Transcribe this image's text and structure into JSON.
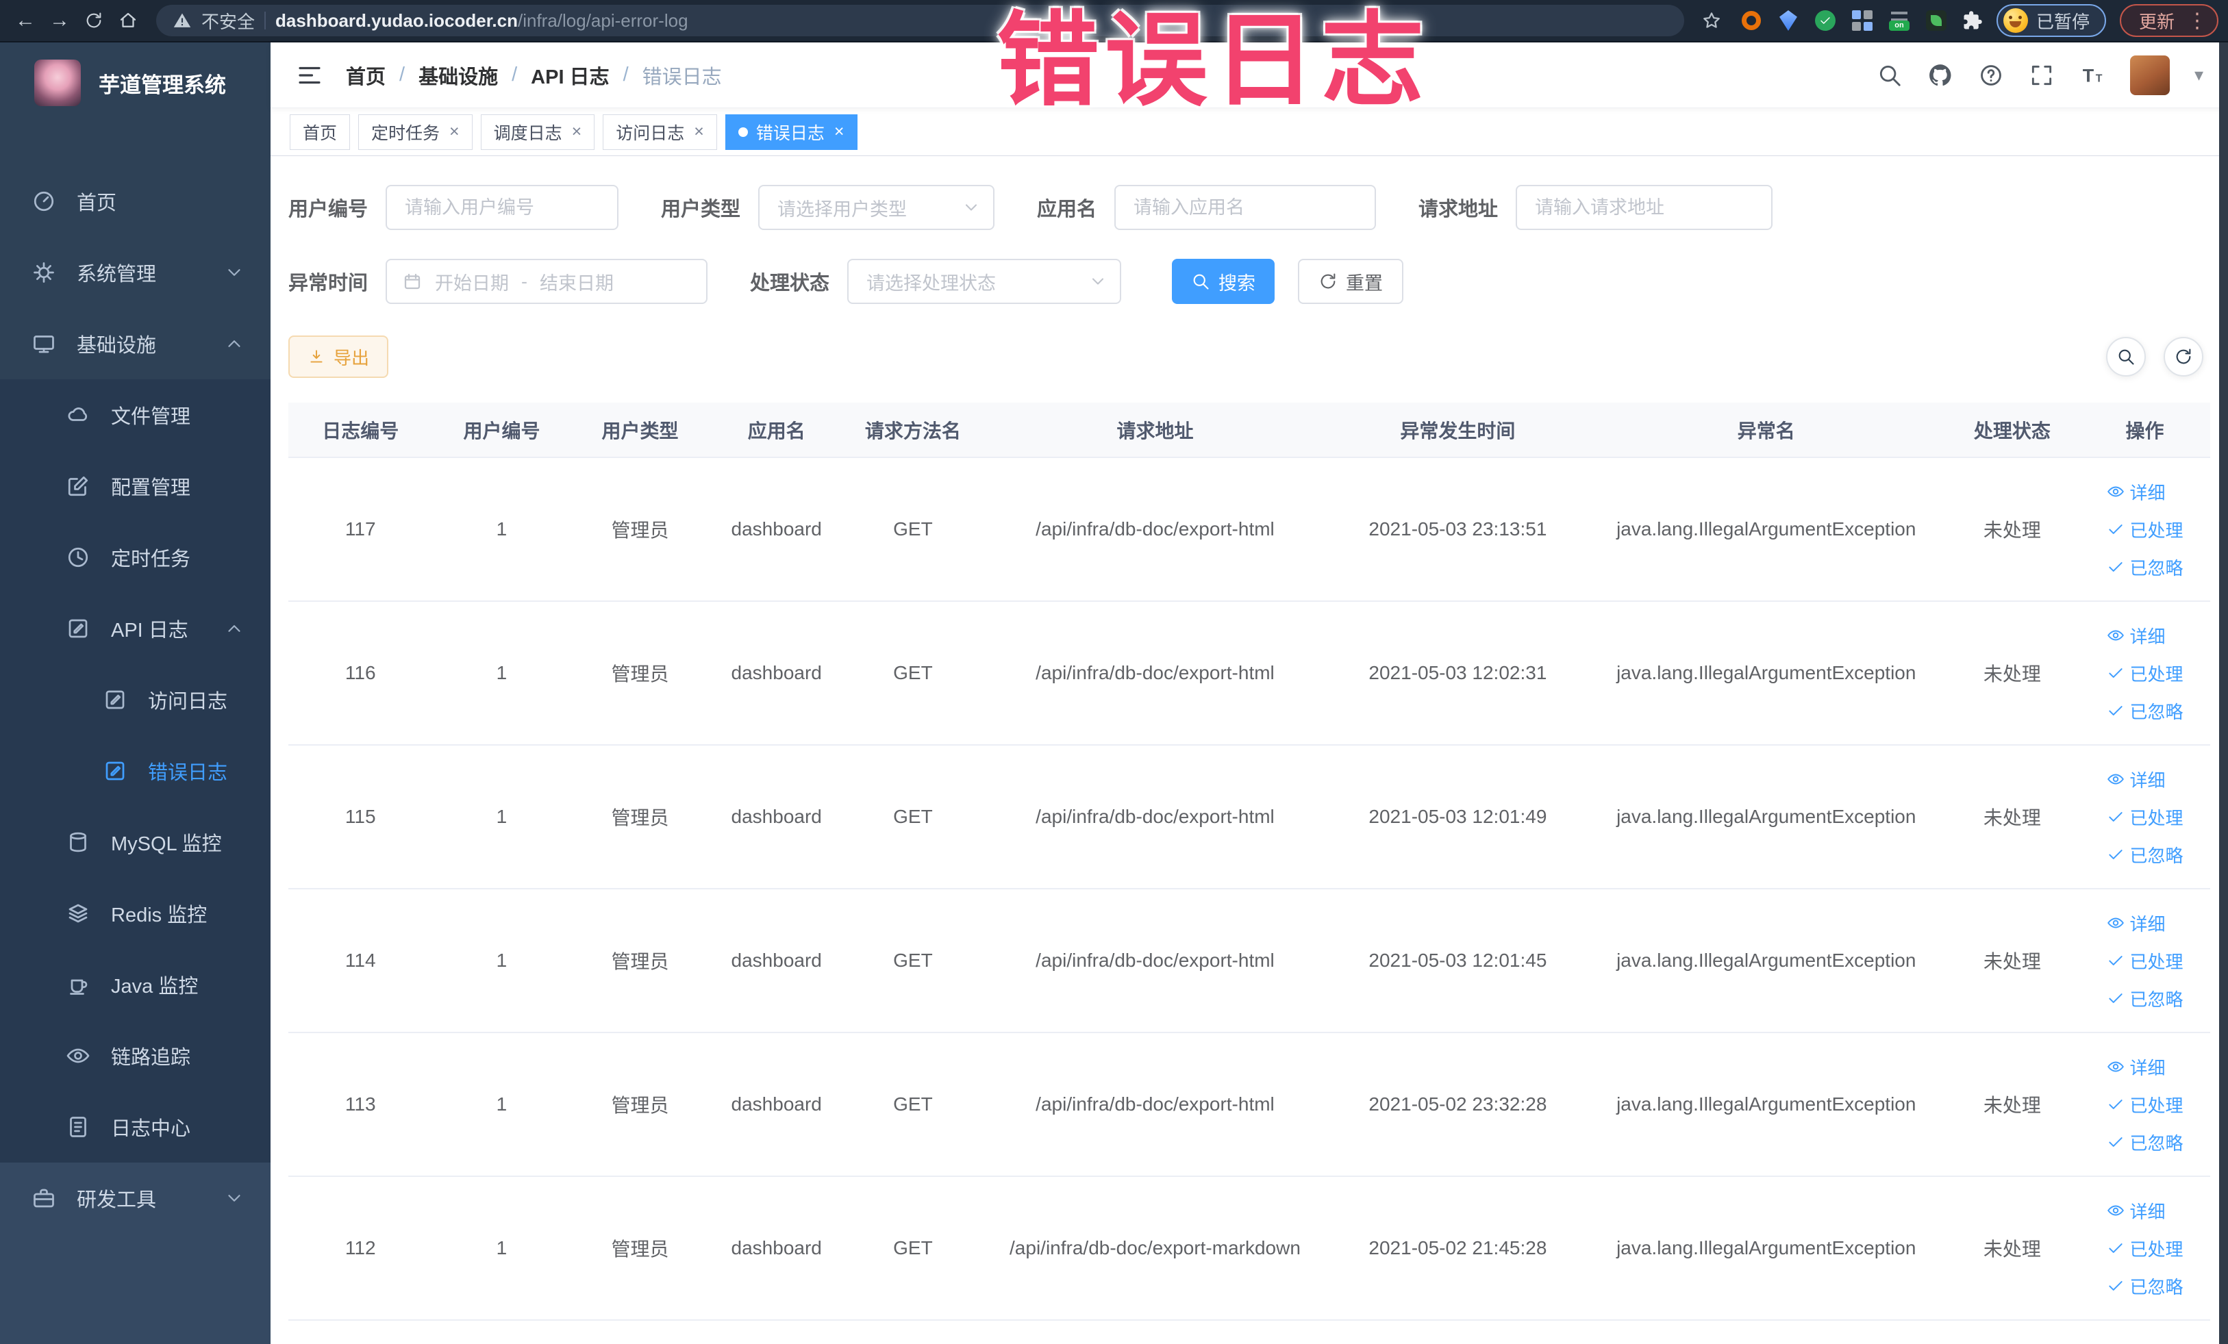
{
  "browser": {
    "security_label": "不安全",
    "url_domain": "dashboard.yudao.iocoder.cn",
    "url_path": "/infra/log/api-error-log",
    "paused_badge": "已暂停",
    "update_button": "更新"
  },
  "icons": {
    "back": "←",
    "forward": "→",
    "kebab": "⋮",
    "caret": "▾",
    "close": "×"
  },
  "colors": {
    "primary": "#409eff",
    "annotation": "#f2426e",
    "warning": "#e6a23c",
    "sidebar": "#2e4156"
  },
  "annotation": {
    "text": "错误日志"
  },
  "sidebar": {
    "title": "芋道管理系统",
    "items": [
      {
        "id": "home",
        "label": "首页",
        "icon": "gauge",
        "level": 1
      },
      {
        "id": "system",
        "label": "系统管理",
        "icon": "gear",
        "level": 1,
        "chevron": "down"
      },
      {
        "id": "infra",
        "label": "基础设施",
        "icon": "monitor",
        "level": 1,
        "chevron": "up"
      },
      {
        "id": "file",
        "label": "文件管理",
        "icon": "cloud",
        "level": 2,
        "group": "sub"
      },
      {
        "id": "config",
        "label": "配置管理",
        "icon": "edit",
        "level": 2,
        "group": "sub"
      },
      {
        "id": "job",
        "label": "定时任务",
        "icon": "clock",
        "level": 2,
        "group": "sub"
      },
      {
        "id": "api-log",
        "label": "API 日志",
        "icon": "log",
        "level": 2,
        "chevron": "up",
        "group": "sub"
      },
      {
        "id": "access-log",
        "label": "访问日志",
        "icon": "log",
        "level": 3,
        "group": "sub"
      },
      {
        "id": "error-log",
        "label": "错误日志",
        "icon": "log",
        "level": 3,
        "group": "sub",
        "active": true
      },
      {
        "id": "mysql",
        "label": "MySQL 监控",
        "icon": "database",
        "level": 2,
        "group": "sub"
      },
      {
        "id": "redis",
        "label": "Redis 监控",
        "icon": "layers",
        "level": 2,
        "group": "sub"
      },
      {
        "id": "java",
        "label": "Java 监控",
        "icon": "java",
        "level": 2,
        "group": "sub"
      },
      {
        "id": "trace",
        "label": "链路追踪",
        "icon": "eye",
        "level": 2,
        "group": "sub"
      },
      {
        "id": "log-center",
        "label": "日志中心",
        "icon": "doc",
        "level": 2,
        "group": "sub"
      },
      {
        "id": "dev-tools",
        "label": "研发工具",
        "icon": "briefcase",
        "level": 1,
        "chevron": "down",
        "group": "bottom"
      }
    ]
  },
  "header": {
    "breadcrumb": [
      "首页",
      "基础设施",
      "API 日志",
      "错误日志"
    ]
  },
  "tabs": [
    {
      "label": "首页",
      "closable": false,
      "active": false
    },
    {
      "label": "定时任务",
      "closable": true,
      "active": false
    },
    {
      "label": "调度日志",
      "closable": true,
      "active": false
    },
    {
      "label": "访问日志",
      "closable": true,
      "active": false
    },
    {
      "label": "错误日志",
      "closable": true,
      "active": true
    }
  ],
  "filters": {
    "fields": [
      {
        "label": "用户编号",
        "type": "input",
        "placeholder": "请输入用户编号"
      },
      {
        "label": "用户类型",
        "type": "select",
        "placeholder": "请选择用户类型"
      },
      {
        "label": "应用名",
        "type": "input",
        "placeholder": "请输入应用名"
      },
      {
        "label": "请求地址",
        "type": "input",
        "placeholder": "请输入请求地址"
      }
    ],
    "date_field": {
      "label": "异常时间",
      "start_placeholder": "开始日期",
      "separator": "-",
      "end_placeholder": "结束日期"
    },
    "status_field": {
      "label": "处理状态",
      "placeholder": "请选择处理状态"
    },
    "search_button": "搜索",
    "reset_button": "重置"
  },
  "toolbar": {
    "export_button": "导出"
  },
  "table": {
    "columns": [
      "日志编号",
      "用户编号",
      "用户类型",
      "应用名",
      "请求方法名",
      "请求地址",
      "异常发生时间",
      "异常名",
      "处理状态",
      "操作"
    ],
    "rows": [
      {
        "id": "117",
        "user_id": "1",
        "user_type": "管理员",
        "app": "dashboard",
        "method": "GET",
        "url": "/api/infra/db-doc/export-html",
        "time": "2021-05-03 23:13:51",
        "exception": "java.lang.IllegalArgumentException",
        "status": "未处理"
      },
      {
        "id": "116",
        "user_id": "1",
        "user_type": "管理员",
        "app": "dashboard",
        "method": "GET",
        "url": "/api/infra/db-doc/export-html",
        "time": "2021-05-03 12:02:31",
        "exception": "java.lang.IllegalArgumentException",
        "status": "未处理"
      },
      {
        "id": "115",
        "user_id": "1",
        "user_type": "管理员",
        "app": "dashboard",
        "method": "GET",
        "url": "/api/infra/db-doc/export-html",
        "time": "2021-05-03 12:01:49",
        "exception": "java.lang.IllegalArgumentException",
        "status": "未处理"
      },
      {
        "id": "114",
        "user_id": "1",
        "user_type": "管理员",
        "app": "dashboard",
        "method": "GET",
        "url": "/api/infra/db-doc/export-html",
        "time": "2021-05-03 12:01:45",
        "exception": "java.lang.IllegalArgumentException",
        "status": "未处理"
      },
      {
        "id": "113",
        "user_id": "1",
        "user_type": "管理员",
        "app": "dashboard",
        "method": "GET",
        "url": "/api/infra/db-doc/export-html",
        "time": "2021-05-02 23:32:28",
        "exception": "java.lang.IllegalArgumentException",
        "status": "未处理"
      },
      {
        "id": "112",
        "user_id": "1",
        "user_type": "管理员",
        "app": "dashboard",
        "method": "GET",
        "url": "/api/infra/db-doc/export-markdown",
        "time": "2021-05-02 21:45:28",
        "exception": "java.lang.IllegalArgumentException",
        "status": "未处理"
      }
    ],
    "actions": [
      {
        "id": "detail",
        "label": "详细",
        "icon": "eye"
      },
      {
        "id": "processed",
        "label": "已处理",
        "icon": "check"
      },
      {
        "id": "ignored",
        "label": "已忽略",
        "icon": "check"
      }
    ]
  }
}
